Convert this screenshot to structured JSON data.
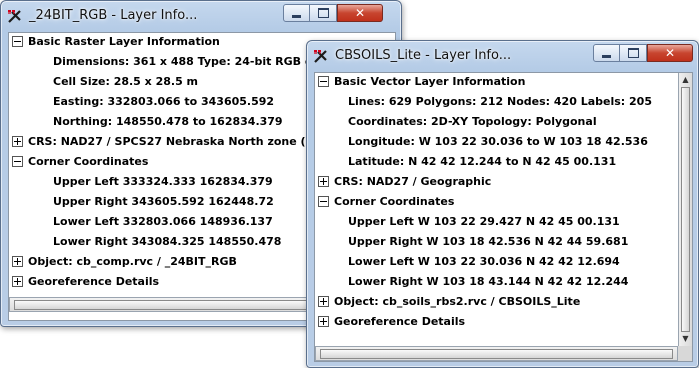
{
  "window1": {
    "title": "_24BIT_RGB - Layer Info...",
    "tree": {
      "basic": "Basic Raster Layer Information",
      "dims": "Dimensions: 361 x 488  Type: 24-bit RGB comp",
      "cell": "Cell Size: 28.5 x 28.5 m",
      "easting": "Easting: 332803.066 to 343605.592",
      "northing": "Northing: 148550.478 to 162834.379",
      "crs": "CRS: NAD27 / SPCS27 Nebraska North zone (m)",
      "corner": "Corner Coordinates",
      "ul": "Upper Left 333324.333 162834.379",
      "ur": "Upper Right 343605.592 162448.72",
      "ll": "Lower Left 332803.066 148936.137",
      "lr": "Lower Right 343084.325 148550.478",
      "object": "Object: cb_comp.rvc / _24BIT_RGB",
      "georef": "Georeference Details"
    }
  },
  "window2": {
    "title": "CBSOILS_Lite - Layer Info...",
    "tree": {
      "basic": "Basic Vector Layer Information",
      "lines": "Lines: 629  Polygons: 212  Nodes: 420  Labels: 205",
      "coords": "Coordinates: 2D-XY  Topology: Polygonal",
      "lon": "Longitude: W 103 22 30.036 to W 103 18 42.536",
      "lat": "Latitude: N 42 42 12.244 to N 42 45 00.131",
      "crs": "CRS: NAD27 / Geographic",
      "corner": "Corner Coordinates",
      "ul": "Upper Left W 103 22 29.427 N 42 45 00.131",
      "ur": "Upper Right W 103 18 42.536 N 42 44 59.681",
      "ll": "Lower Left W 103 22 30.036 N 42 42 12.694",
      "lr": "Lower Right W 103 18 43.144 N 42 42 12.244",
      "object": "Object: cb_soils_rbs2.rvc / CBSOILS_Lite",
      "georef": "Georeference Details"
    }
  },
  "controls": {
    "close_glyph": "✕"
  },
  "colors": {
    "titlebar": "#b9cde6",
    "close": "#c8452f",
    "window_border": "#5a6f8c"
  }
}
